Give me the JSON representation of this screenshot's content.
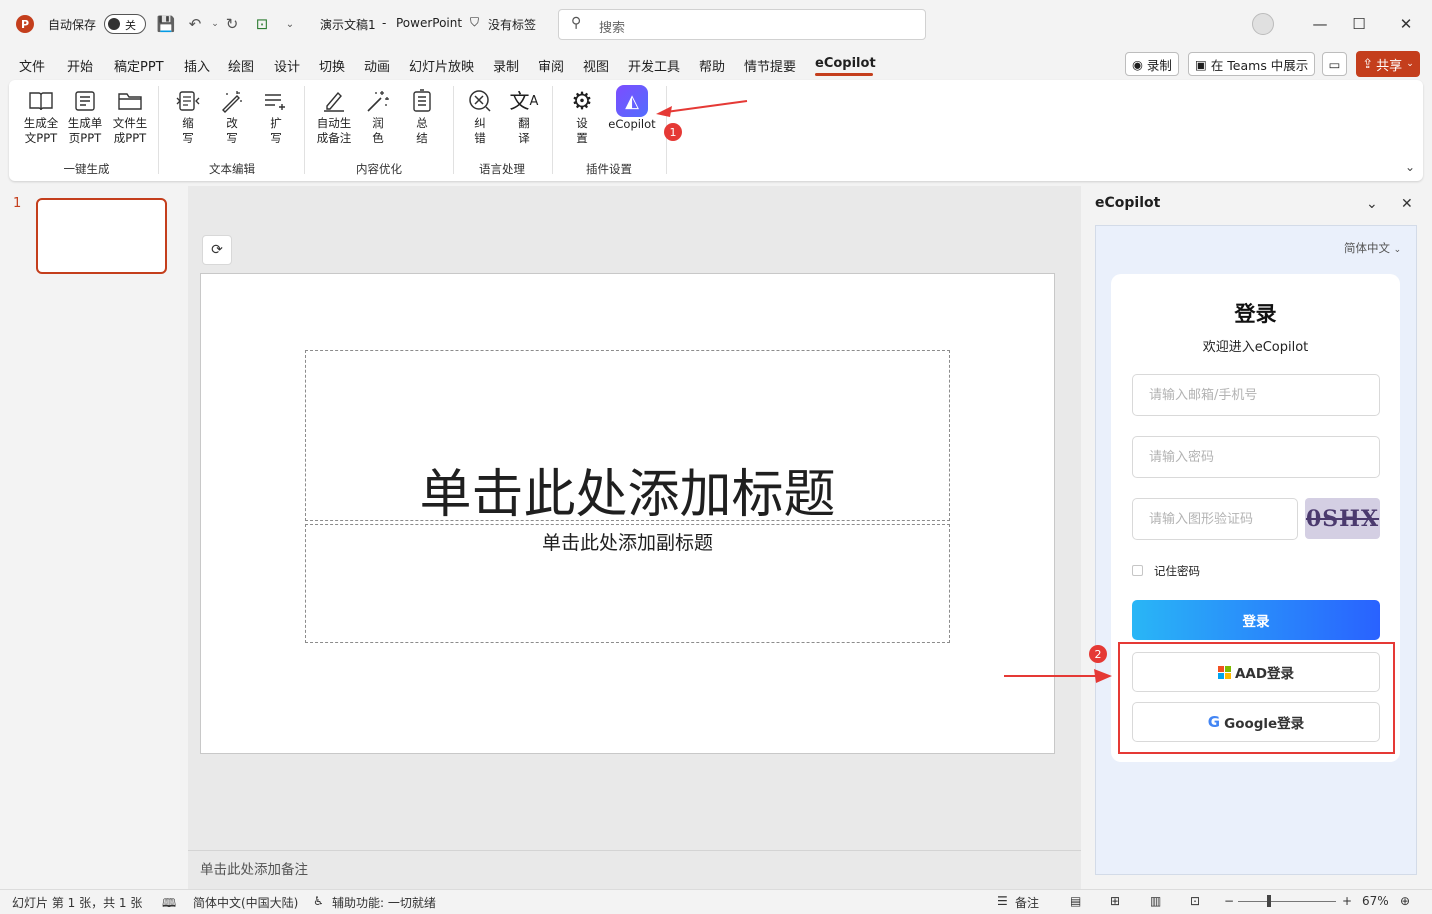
{
  "titlebar": {
    "app_logo": "P",
    "autosave_label": "自动保存",
    "autosave_state": "关",
    "doc_title": "演示文稿1",
    "separator": "-",
    "app_name": "PowerPoint",
    "sensitivity": "没有标签",
    "search_placeholder": "搜索"
  },
  "menu": {
    "items": [
      "文件",
      "开始",
      "稿定PPT",
      "插入",
      "绘图",
      "设计",
      "切换",
      "动画",
      "幻灯片放映",
      "录制",
      "审阅",
      "视图",
      "开发工具",
      "帮助",
      "情节提要",
      "eCopilot"
    ],
    "active": "eCopilot",
    "record_btn": "录制",
    "teams_btn": "在 Teams 中展示",
    "share_btn": "共享"
  },
  "ribbon": {
    "buttons": [
      {
        "label1": "生成全",
        "label2": "文PPT"
      },
      {
        "label1": "生成单",
        "label2": "页PPT"
      },
      {
        "label1": "文件生",
        "label2": "成PPT"
      },
      {
        "label1": "缩",
        "label2": "写"
      },
      {
        "label1": "改",
        "label2": "写"
      },
      {
        "label1": "扩",
        "label2": "写"
      },
      {
        "label1": "自动生",
        "label2": "成备注"
      },
      {
        "label1": "润",
        "label2": "色"
      },
      {
        "label1": "总",
        "label2": "结"
      },
      {
        "label1": "纠",
        "label2": "错"
      },
      {
        "label1": "翻",
        "label2": "译"
      },
      {
        "label1": "设",
        "label2": "置"
      },
      {
        "label1": "eCopilot",
        "label2": ""
      }
    ],
    "groups": [
      "一键生成",
      "文本编辑",
      "内容优化",
      "语言处理",
      "插件设置"
    ],
    "badge1": "1"
  },
  "thumbnails": {
    "slide_number": "1"
  },
  "slide": {
    "title_placeholder": "单击此处添加标题",
    "subtitle_placeholder": "单击此处添加副标题"
  },
  "notes": {
    "placeholder": "单击此处添加备注"
  },
  "side_pane": {
    "title": "eCopilot",
    "language": "简体中文",
    "login_heading": "登录",
    "welcome": "欢迎进入eCopilot",
    "email_placeholder": "请输入邮箱/手机号",
    "password_placeholder": "请输入密码",
    "captcha_placeholder": "请输入图形验证码",
    "captcha_text": "0SHX",
    "remember_label": "记住密码",
    "login_button": "登录",
    "aad_button": "AAD登录",
    "google_button": "Google登录",
    "badge2": "2"
  },
  "statusbar": {
    "slide_info": "幻灯片 第 1 张，共 1 张",
    "language": "简体中文(中国大陆)",
    "accessibility": "辅助功能: 一切就绪",
    "notes": "备注",
    "zoom": "67%"
  },
  "colors": {
    "accent": "#c43e1c",
    "annotation": "#e53935",
    "login_gradient_start": "#29b6f6",
    "login_gradient_end": "#2962ff"
  }
}
